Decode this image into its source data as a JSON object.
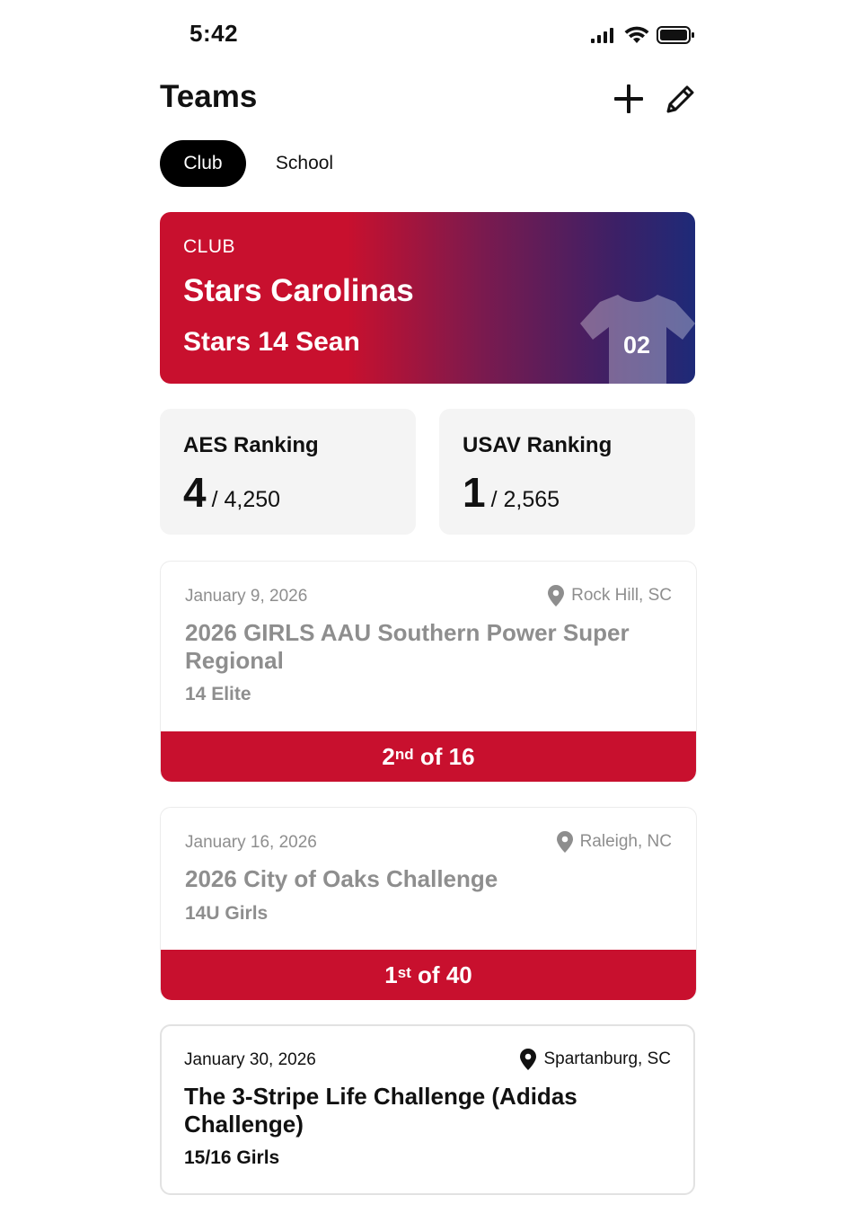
{
  "status_bar": {
    "time": "5:42"
  },
  "header": {
    "title": "Teams"
  },
  "segments": {
    "club": "Club",
    "school": "School"
  },
  "team": {
    "label": "CLUB",
    "club": "Stars Carolinas",
    "name": "Stars 14 Sean",
    "jersey_number": "02"
  },
  "rankings": [
    {
      "title": "AES Ranking",
      "rank": "4",
      "total": "/ 4,250"
    },
    {
      "title": "USAV Ranking",
      "rank": "1",
      "total": "/ 2,565"
    }
  ],
  "events": [
    {
      "date": "January 9, 2026",
      "location": "Rock Hill, SC",
      "name": "2026 GIRLS AAU Southern Power Super Regional",
      "division": "14 Elite",
      "place_num": "2",
      "place_suffix": "nd",
      "place_rest": " of 16"
    },
    {
      "date": "January 16, 2026",
      "location": "Raleigh, NC",
      "name": "2026 City of Oaks Challenge",
      "division": "14U Girls",
      "place_num": "1",
      "place_suffix": "st",
      "place_rest": " of 40"
    },
    {
      "date": "January 30, 2026",
      "location": "Spartanburg, SC",
      "name": "The 3-Stripe Life Challenge (Adidas Challenge)",
      "division": "15/16 Girls"
    }
  ],
  "colors": {
    "accent": "#c8102e",
    "gradient_end": "#1e2a78",
    "muted_text": "#8e8e8e"
  }
}
